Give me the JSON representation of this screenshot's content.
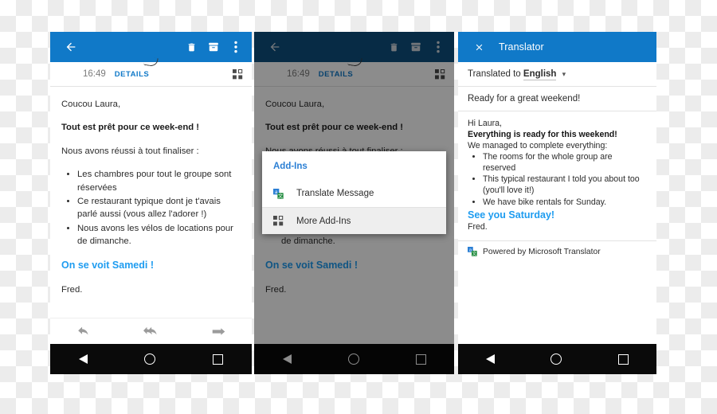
{
  "panel1": {
    "appbar": {
      "back_icon": "arrow-left-icon",
      "delete_icon": "trash-icon",
      "archive_icon": "archive-icon",
      "overflow_icon": "more-vertical-icon"
    },
    "meta": {
      "time": "16:49",
      "details_label": "DETAILS",
      "addins_icon": "add-ins-grid-icon"
    },
    "mail": {
      "greeting": "Coucou Laura,",
      "headline": "Tout est prêt pour ce week-end !",
      "intro": "Nous avons réussi à tout finaliser :",
      "bullets": [
        "Les chambres pour tout le groupe sont réservées",
        "Ce restaurant typique dont je t'avais parlé aussi (vous allez l'adorer !)",
        "Nous avons les vélos de locations pour de dimanche."
      ],
      "signoff": "On se voit Samedi !",
      "signature": "Fred."
    },
    "reply": {
      "reply_icon": "reply-icon",
      "reply_all_icon": "reply-all-icon",
      "forward_icon": "forward-icon"
    }
  },
  "panel2": {
    "dialog": {
      "title": "Add-Ins",
      "items": [
        {
          "label": "Translate Message",
          "icon": "translate-icon"
        },
        {
          "label": "More Add-Ins",
          "icon": "add-ins-grid-icon"
        }
      ]
    }
  },
  "panel3": {
    "appbar": {
      "close_icon": "close-icon",
      "title": "Translator"
    },
    "lang": {
      "prefix": "Translated to",
      "value": "English",
      "chevron_icon": "chevron-down-icon"
    },
    "subject": "Ready for a great weekend!",
    "mail": {
      "greeting": "Hi Laura,",
      "headline": "Everything is ready for this weekend!",
      "intro": "We managed to complete everything:",
      "bullets": [
        "The rooms for the whole group are reserved",
        "This typical restaurant I told you about too (you'll love it!)",
        "We have bike rentals for Sunday."
      ],
      "signoff": "See you Saturday!",
      "signature": "Fred."
    },
    "powered": {
      "icon": "translate-icon",
      "label": "Powered by Microsoft Translator"
    }
  },
  "navbar": {
    "back_icon": "nav-back-triangle-icon",
    "home_icon": "nav-home-circle-icon",
    "recents_icon": "nav-recents-square-icon"
  },
  "colors": {
    "appbar_blue": "#1079c8",
    "appbar_blue_dim": "#0d4f7e",
    "link_blue": "#1e9cf0",
    "dialog_title_blue": "#2b7fd4",
    "details_blue": "#1079c8"
  }
}
